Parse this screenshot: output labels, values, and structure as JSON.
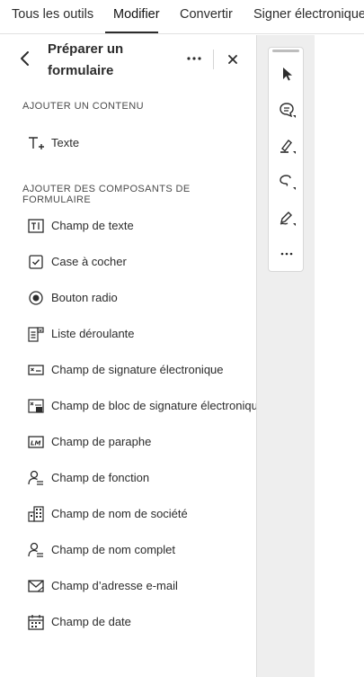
{
  "menubar": {
    "items": [
      "Tous les outils",
      "Modifier",
      "Convertir",
      "Signer électronique"
    ]
  },
  "panel": {
    "title": "Préparer un formulaire",
    "back_icon": "chevron-left-icon",
    "more_icon": "more-horizontal-icon",
    "close_icon": "close-icon",
    "section1": "AJOUTER UN CONTENU",
    "content_items": [
      {
        "label": "Texte",
        "icon": "add-text-icon"
      }
    ],
    "section2": "AJOUTER DES COMPOSANTS DE FORMULAIRE",
    "form_items": [
      {
        "label": "Champ de texte",
        "icon": "text-field-icon"
      },
      {
        "label": "Case à cocher",
        "icon": "checkbox-icon"
      },
      {
        "label": "Bouton radio",
        "icon": "radio-button-icon"
      },
      {
        "label": "Liste déroulante",
        "icon": "dropdown-list-icon"
      },
      {
        "label": "Champ de signature électronique",
        "icon": "signature-field-icon"
      },
      {
        "label": "Champ de bloc de signature électronique",
        "icon": "signature-block-icon"
      },
      {
        "label": "Champ de paraphe",
        "icon": "initials-field-icon"
      },
      {
        "label": "Champ de fonction",
        "icon": "title-person-icon"
      },
      {
        "label": "Champ de nom de société",
        "icon": "company-building-icon"
      },
      {
        "label": "Champ de nom complet",
        "icon": "full-name-person-icon"
      },
      {
        "label": "Champ d’adresse e-mail",
        "icon": "email-envelope-icon"
      },
      {
        "label": "Champ de date",
        "icon": "calendar-icon"
      }
    ]
  },
  "toolrail": {
    "tools": [
      "select-pointer-icon",
      "comment-icon",
      "highlighter-icon",
      "lasso-draw-icon",
      "sign-pen-icon",
      "more-tools-icon"
    ]
  }
}
